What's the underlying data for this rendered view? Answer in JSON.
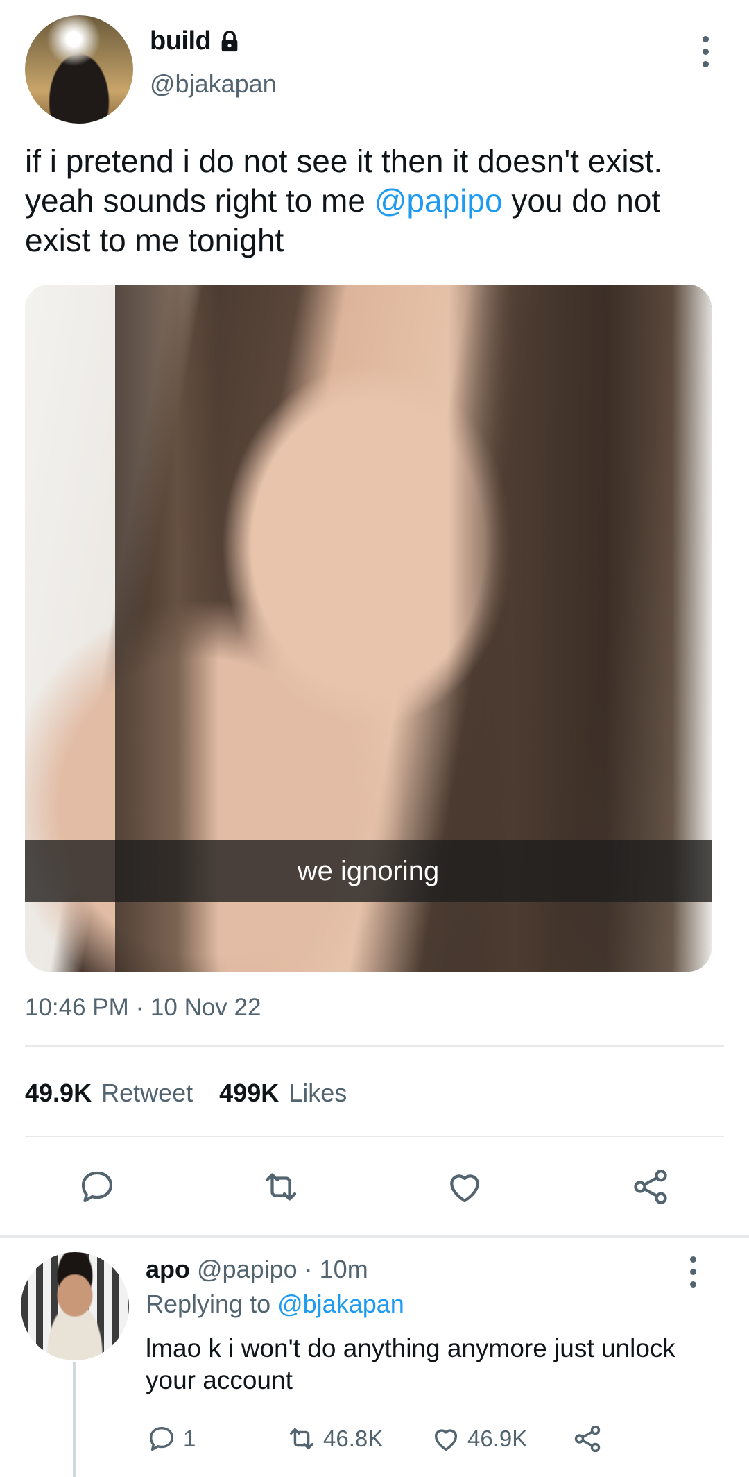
{
  "tweet": {
    "author_name": "build",
    "author_handle": "@bjakapan",
    "text_part1": "if i pretend i do not see it then it doesn't exist. yeah sounds right to me ",
    "mention": "@papipo",
    "text_part2": " you do not exist to me tonight",
    "media_caption": "we ignoring",
    "timestamp": "10:46 PM · 10 Nov 22",
    "retweet_count": "49.9K",
    "retweet_label": "Retweet",
    "likes_count": "499K",
    "likes_label": "Likes"
  },
  "reply": {
    "author_name": "apo",
    "author_handle": "@papipo",
    "time": "· 10m",
    "replying_prefix": "Replying to ",
    "replying_to": "@bjakapan",
    "text": "lmao k i won't do anything anymore just unlock your account",
    "reply_count": "1",
    "retweet_count": "46.8K",
    "like_count": "46.9K"
  },
  "icons": [
    "lock-icon",
    "more-icon",
    "reply-icon",
    "retweet-icon",
    "like-icon",
    "share-icon"
  ],
  "colors": {
    "text": "#0f1419",
    "secondary": "#536471",
    "link": "#1d9bf0",
    "divider": "#e7e9ea"
  }
}
